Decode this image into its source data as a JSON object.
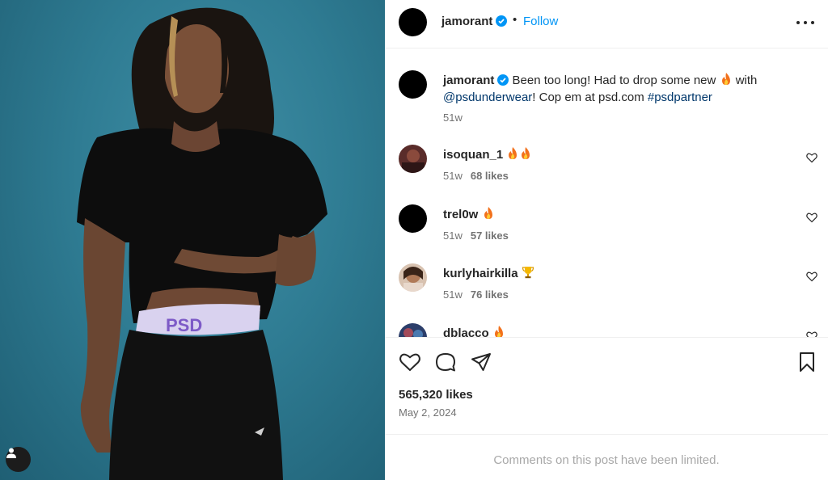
{
  "photo": {
    "description_icon": "user-tag-icon",
    "underwear_band_text": "PSD",
    "background_color": "#2f7c93"
  },
  "header": {
    "username": "jamorant",
    "separator": "•",
    "follow_label": "Follow",
    "more_icon": "more-horizontal-icon"
  },
  "caption": {
    "username": "jamorant",
    "text_before_emoji": "Been too long! Had to drop some new",
    "text_after_emoji": "with",
    "mention": "@psdunderwear",
    "text_after_mention": "! Cop em at psd.com",
    "hashtag": "#psdpartner",
    "age": "51w"
  },
  "comments": [
    {
      "username": "isoquan_1",
      "emoji": "fire-fire",
      "age": "51w",
      "likes": "68 likes"
    },
    {
      "username": "trel0w",
      "emoji": "fire",
      "age": "51w",
      "likes": "57 likes"
    },
    {
      "username": "kurlyhairkilla",
      "emoji": "trophy",
      "age": "51w",
      "likes": "76 likes"
    },
    {
      "username": "dblacco",
      "emoji": "fire",
      "age": "",
      "likes": ""
    }
  ],
  "actions": {
    "like_icon": "heart-icon",
    "comment_icon": "comment-icon",
    "share_icon": "share-icon",
    "save_icon": "bookmark-icon"
  },
  "likes_count": "565,320 likes",
  "post_date": "May 2, 2024",
  "comments_limited_text": "Comments on this post have been limited.",
  "colors": {
    "accent_blue": "#0095f6",
    "link_blue": "#00376b",
    "verified_blue": "#0095f6",
    "muted_text": "#737373",
    "limited_text": "#a8a8a8"
  }
}
